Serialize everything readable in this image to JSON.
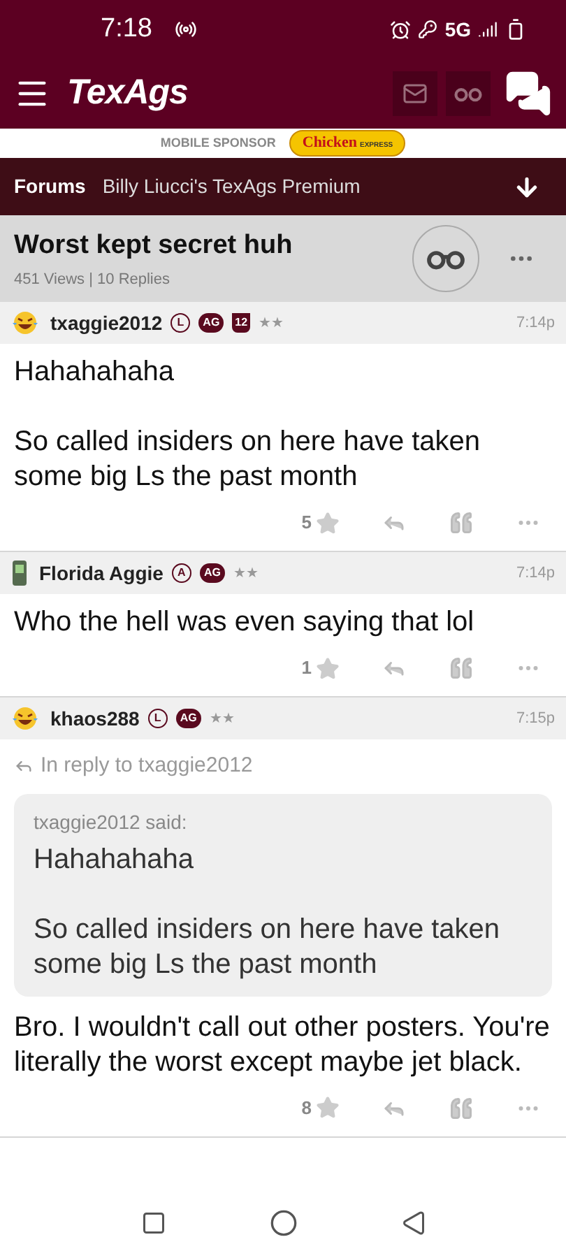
{
  "status_bar": {
    "time": "7:18",
    "network": "5G"
  },
  "header": {
    "logo": "TexAgs"
  },
  "sponsor": {
    "label": "MOBILE SPONSOR",
    "logo_text": "Chicken",
    "logo_subtext": "EXPRESS"
  },
  "breadcrumb": {
    "section": "Forums",
    "board": "Billy Liucci's TexAgs Premium"
  },
  "thread": {
    "title": "Worst kept secret huh",
    "stats": "451 Views | 10 Replies"
  },
  "posts": [
    {
      "author": "txaggie2012",
      "kind": "laugh",
      "badges": [
        {
          "kind": "circle",
          "text": "L"
        },
        {
          "kind": "pill",
          "text": "AG"
        },
        {
          "kind": "shield",
          "text": "12"
        }
      ],
      "rank": "★★",
      "time": "7:14p",
      "paragraphs": [
        "Hahahahaha",
        "So called insiders on here have taken some big Ls the past month"
      ],
      "stars": "5"
    },
    {
      "author": "Florida Aggie",
      "kind": "phone",
      "badges": [
        {
          "kind": "circle",
          "text": "A"
        },
        {
          "kind": "pill",
          "text": "AG"
        }
      ],
      "rank": "★★",
      "time": "7:14p",
      "paragraphs": [
        "Who the hell was even saying that lol"
      ],
      "stars": "1"
    },
    {
      "author": "khaos288",
      "kind": "laugh",
      "badges": [
        {
          "kind": "circle",
          "text": "L"
        },
        {
          "kind": "pill",
          "text": "AG"
        }
      ],
      "rank": "★★",
      "time": "7:15p",
      "reply_to": "In reply to txaggie2012",
      "quote": {
        "said": "txaggie2012 said:",
        "paragraphs": [
          "Hahahahaha",
          "So called insiders on here have taken some big Ls the past month"
        ]
      },
      "paragraphs": [
        "Bro. I wouldn't call out other posters. You're literally the worst except maybe jet black."
      ],
      "stars": "8"
    }
  ]
}
